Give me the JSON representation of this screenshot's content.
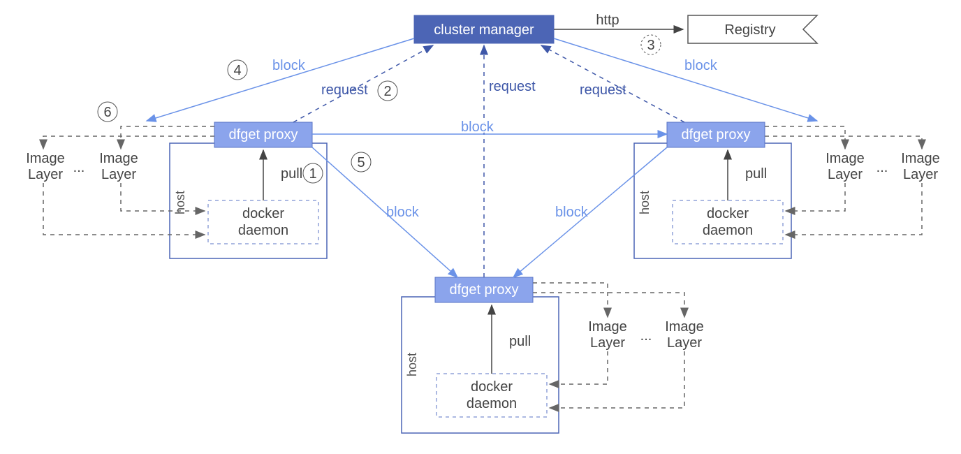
{
  "nodes": {
    "cluster_manager": "cluster manager",
    "registry": "Registry",
    "dfget_proxy": "dfget proxy",
    "docker_daemon_l1": "docker",
    "docker_daemon_l2": "daemon",
    "host": "host",
    "image": "Image",
    "layer": "Layer",
    "ellipsis": "..."
  },
  "edges": {
    "http": "http",
    "block": "block",
    "request": "request",
    "pull": "pull"
  },
  "steps": {
    "s1": "1",
    "s2": "2",
    "s3": "3",
    "s4": "4",
    "s5": "5",
    "s6": "6"
  }
}
